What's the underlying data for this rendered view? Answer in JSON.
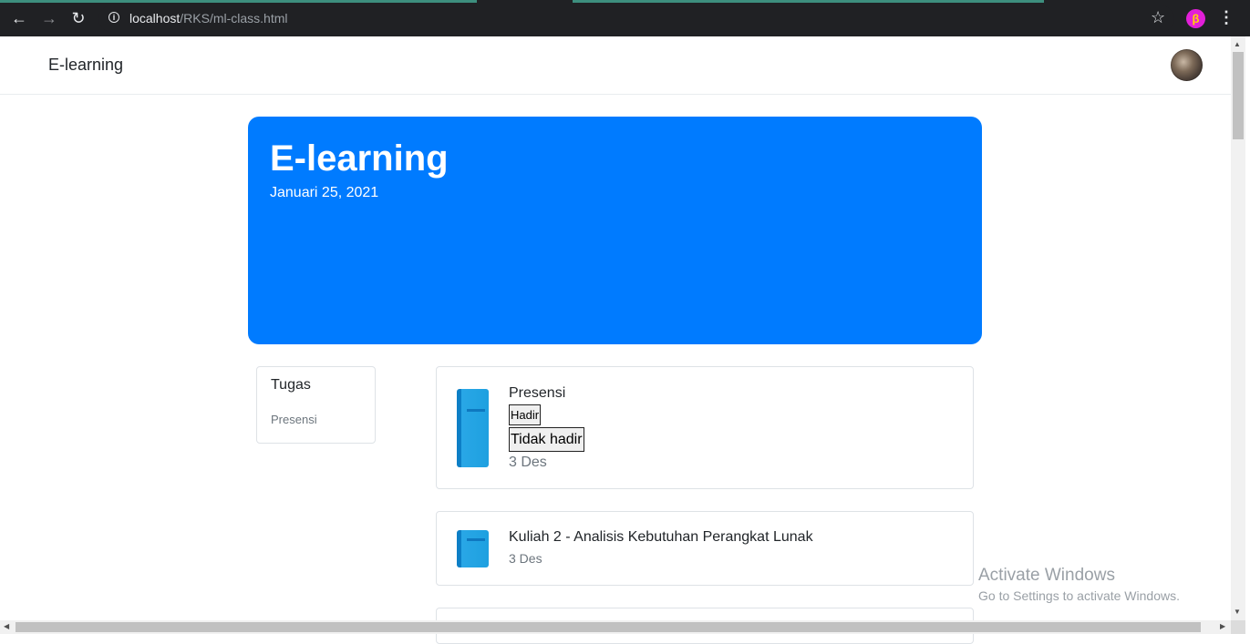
{
  "browser": {
    "url_host": "localhost",
    "url_path": "/RKS/ml-class.html"
  },
  "navbar": {
    "brand": "E-learning"
  },
  "banner": {
    "title": "E-learning",
    "date": "Januari 25, 2021",
    "color": "#007bff"
  },
  "sidebar": {
    "title": "Tugas",
    "items": [
      {
        "label": "Presensi"
      }
    ]
  },
  "posts": [
    {
      "title": "Presensi",
      "buttons": [
        {
          "label": "Hadir"
        },
        {
          "label": "Tidak hadir"
        }
      ],
      "date": "3 Des"
    },
    {
      "title": "Kuliah 2 - Analisis Kebutuhan Perangkat Lunak",
      "date": "3 Des"
    }
  ],
  "watermark": {
    "title": "Activate Windows",
    "subtitle": "Go to Settings to activate Windows."
  }
}
